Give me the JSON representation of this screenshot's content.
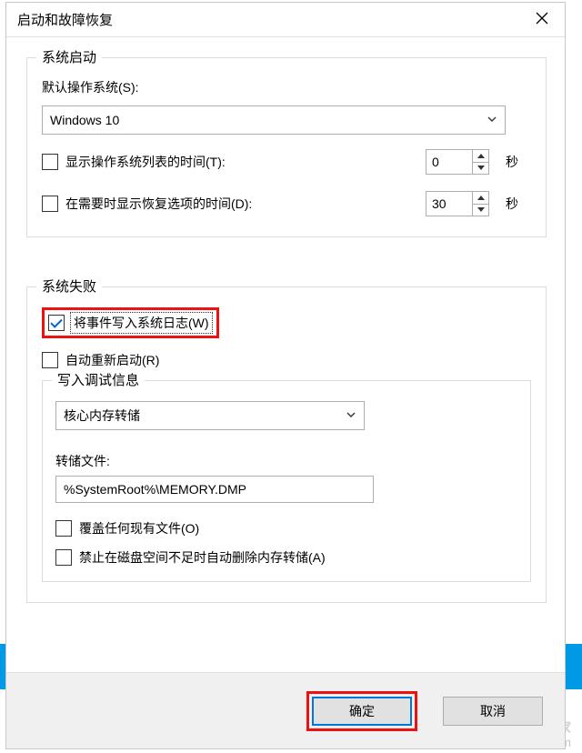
{
  "window": {
    "title": "启动和故障恢复"
  },
  "startup": {
    "legend": "系统启动",
    "default_os_label": "默认操作系统(S):",
    "selected_os": "Windows 10",
    "show_os_list_label": "显示操作系统列表的时间(T):",
    "show_os_list_seconds": "0",
    "show_recovery_label": "在需要时显示恢复选项的时间(D):",
    "show_recovery_seconds": "30",
    "seconds_unit": "秒"
  },
  "failure": {
    "legend": "系统失败",
    "write_event_label": "将事件写入系统日志(W)",
    "auto_restart_label": "自动重新启动(R)",
    "debug_legend": "写入调试信息",
    "dump_type": "核心内存转储",
    "dump_file_label": "转储文件:",
    "dump_file_value": "%SystemRoot%\\MEMORY.DMP",
    "overwrite_label": "覆盖任何现有文件(O)",
    "disable_autodelete_label": "禁止在磁盘空间不足时自动删除内存转储(A)"
  },
  "buttons": {
    "ok": "确定",
    "cancel": "取消"
  },
  "watermark": {
    "line1": "装机之家",
    "line2": "www.lotpc.com"
  }
}
